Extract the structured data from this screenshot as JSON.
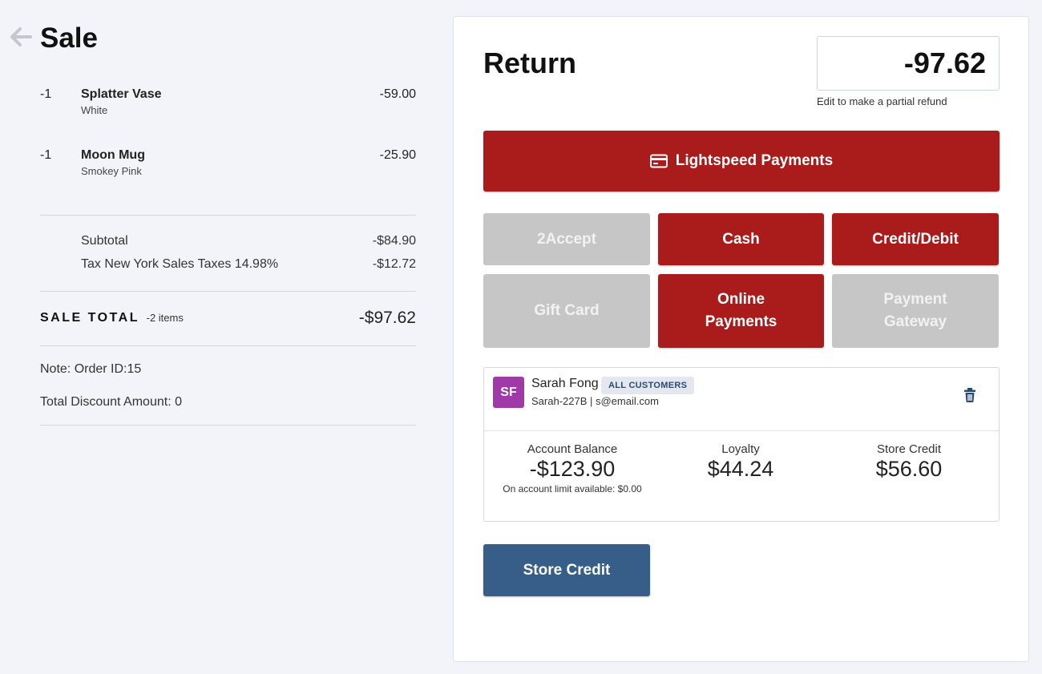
{
  "sale": {
    "title": "Sale",
    "items": [
      {
        "qty": "-1",
        "name": "Splatter Vase",
        "variant": "White",
        "price": "-59.00"
      },
      {
        "qty": "-1",
        "name": "Moon Mug",
        "variant": "Smokey Pink",
        "price": "-25.90"
      }
    ],
    "subtotal_label": "Subtotal",
    "subtotal_value": "-$84.90",
    "tax_label": "Tax New York Sales Taxes 14.98%",
    "tax_value": "-$12.72",
    "total_label": "SALE TOTAL",
    "total_items": "-2 items",
    "total_value": "-$97.62",
    "note": "Note: Order ID:15",
    "discount": "Total Discount Amount: 0"
  },
  "return_panel": {
    "title": "Return",
    "amount_value": "-97.62",
    "amount_hint": "Edit to make a partial refund",
    "primary_payment": "Lightspeed Payments",
    "payment_methods": [
      {
        "label": "2Accept",
        "enabled": false
      },
      {
        "label": "Cash",
        "enabled": true
      },
      {
        "label": "Credit/Debit",
        "enabled": true
      },
      {
        "label": "Gift Card",
        "enabled": false
      },
      {
        "label": "Online Payments",
        "enabled": true
      },
      {
        "label": "Payment Gateway",
        "enabled": false
      }
    ],
    "store_credit_button": "Store Credit"
  },
  "customer": {
    "initials": "SF",
    "name": "Sarah Fong",
    "group": "ALL CUSTOMERS",
    "details": "Sarah-227B | s@email.com",
    "account_balance_label": "Account Balance",
    "account_balance_value": "-$123.90",
    "account_limit_note": "On account limit available: $0.00",
    "loyalty_label": "Loyalty",
    "loyalty_value": "$44.24",
    "store_credit_label": "Store Credit",
    "store_credit_value": "$56.60"
  },
  "icons": {
    "back": "arrow-left-icon",
    "card": "credit-card-icon",
    "delete": "trash-icon"
  },
  "colors": {
    "accent_red": "#aa1c1c",
    "disabled_grey": "#c6c6c6",
    "store_credit_blue": "#365e89",
    "avatar_purple": "#a03aa8",
    "background": "#f3f4f9"
  }
}
